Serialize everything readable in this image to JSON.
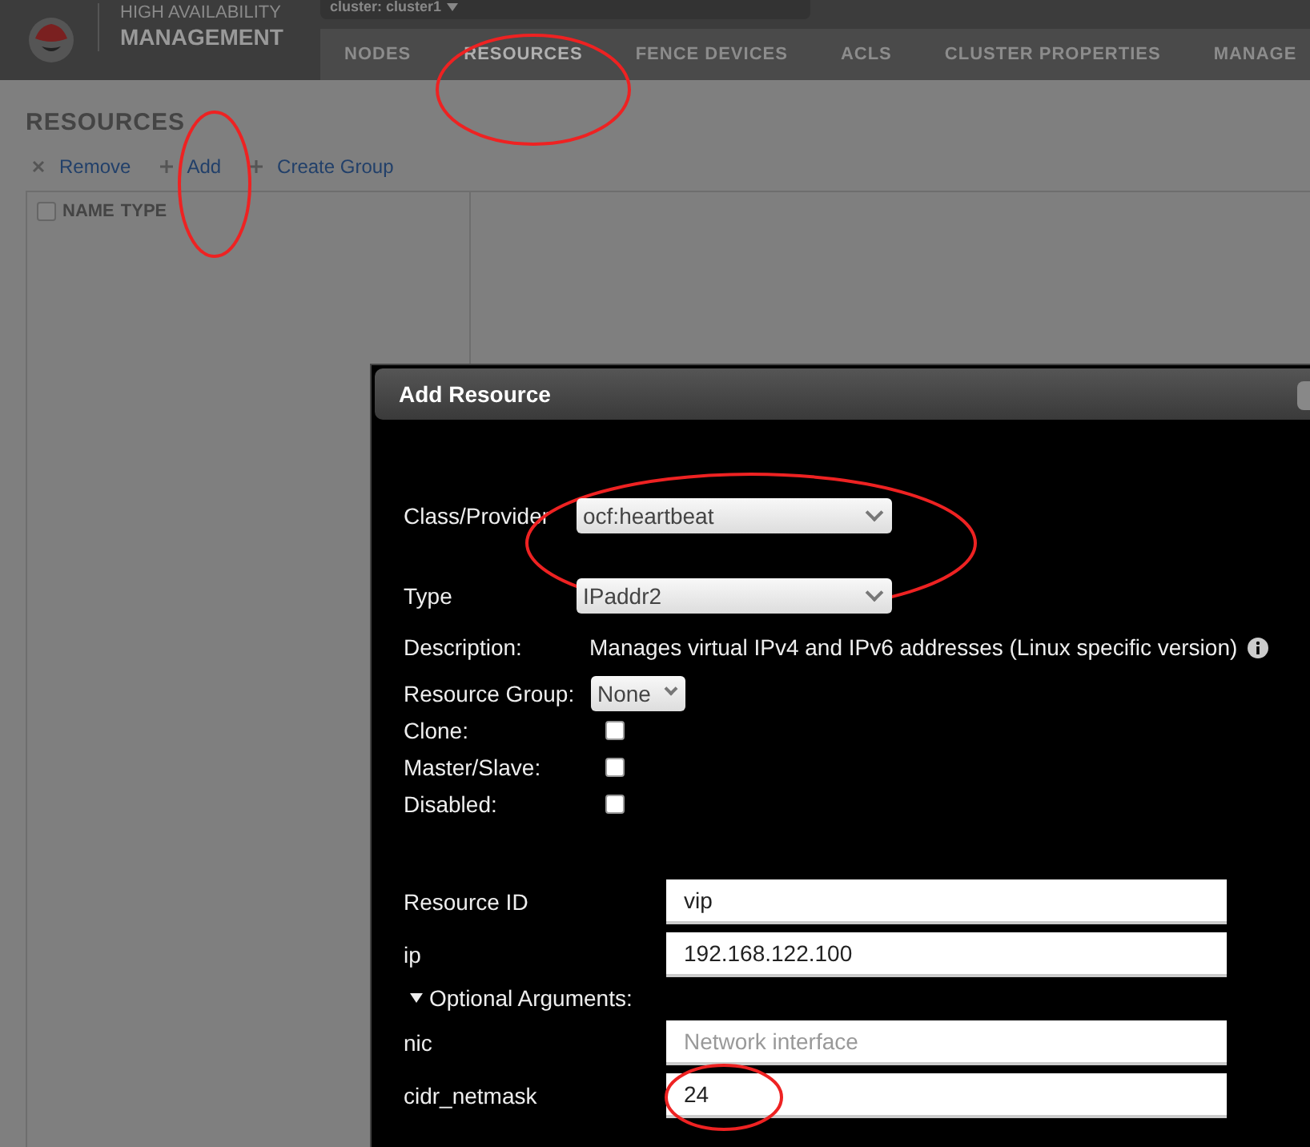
{
  "header": {
    "product_line1": "HIGH AVAILABILITY",
    "product_line2": "MANAGEMENT",
    "cluster": "cluster: cluster1"
  },
  "nav_tabs": [
    {
      "label": "NODES",
      "selected": false
    },
    {
      "label": "RESOURCES",
      "selected": true
    },
    {
      "label": "FENCE DEVICES",
      "selected": false
    },
    {
      "label": "ACLS",
      "selected": false
    },
    {
      "label": "CLUSTER PROPERTIES",
      "selected": false
    },
    {
      "label": "MANAGE",
      "selected": false
    }
  ],
  "page": {
    "title": "RESOURCES",
    "actions": [
      {
        "kind": "remove",
        "label": "Remove"
      },
      {
        "kind": "add",
        "label": "Add"
      },
      {
        "kind": "add",
        "label": "Create Group"
      }
    ],
    "table": {
      "select_all_checked": false,
      "columns": [
        "NAME",
        "TYPE"
      ]
    }
  },
  "dialog": {
    "title": "Add Resource",
    "class_provider": {
      "label": "Class/Provider",
      "value": "ocf:heartbeat"
    },
    "type": {
      "label": "Type",
      "value": "IPaddr2"
    },
    "description": {
      "label": "Description:",
      "text": "Manages virtual IPv4 and IPv6 addresses (Linux specific version)"
    },
    "resource_group": {
      "label": "Resource Group:",
      "value": "None"
    },
    "options": [
      {
        "label": "Clone:",
        "checked": false
      },
      {
        "label": "Master/Slave:",
        "checked": false
      },
      {
        "label": "Disabled:",
        "checked": false
      }
    ],
    "fields": [
      {
        "label": "Resource ID",
        "value": "vip"
      },
      {
        "label": "ip",
        "value": "192.168.122.100"
      }
    ],
    "optional_section": {
      "label": "Optional Arguments:",
      "expanded": true
    },
    "optional_fields": [
      {
        "label": "nic",
        "placeholder": "Network interface"
      },
      {
        "label": "cidr_netmask",
        "value": "24"
      }
    ]
  }
}
